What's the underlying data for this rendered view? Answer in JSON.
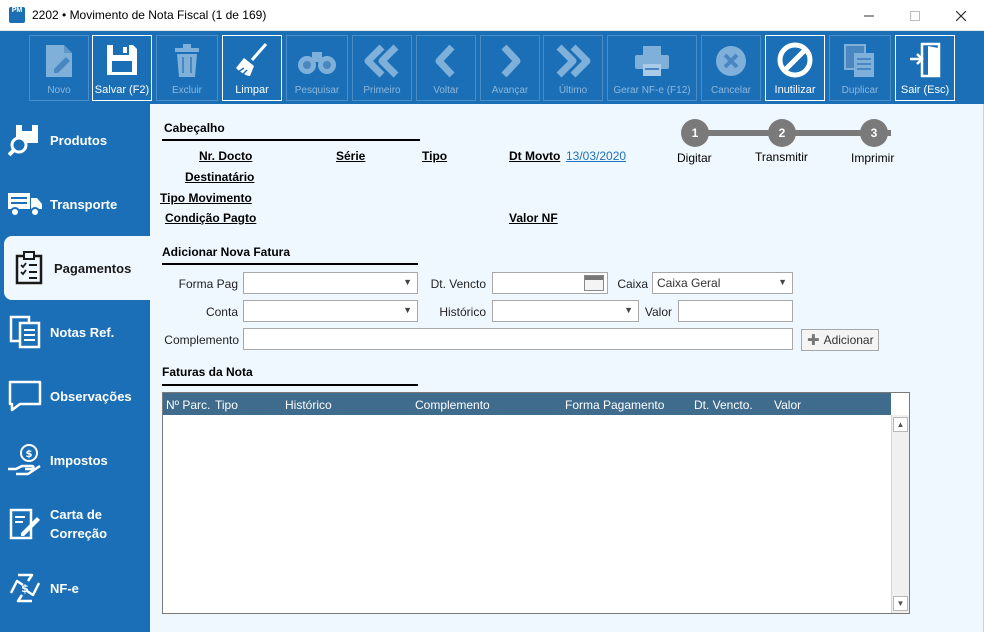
{
  "window": {
    "app_icon_text": "PM",
    "title": "2202 • Movimento de Nota Fiscal (1 de 169)"
  },
  "toolbar": {
    "buttons": [
      {
        "label": "Novo",
        "icon": "new-document-icon",
        "enabled": false
      },
      {
        "label": "Salvar (F2)",
        "icon": "floppy-save-icon",
        "enabled": true
      },
      {
        "label": "Excluir",
        "icon": "trash-icon",
        "enabled": false
      },
      {
        "label": "Limpar",
        "icon": "broom-icon",
        "enabled": true
      },
      {
        "label": "Pesquisar",
        "icon": "binoculars-icon",
        "enabled": false
      },
      {
        "label": "Primeiro",
        "icon": "first-icon",
        "enabled": false
      },
      {
        "label": "Voltar",
        "icon": "previous-icon",
        "enabled": false
      },
      {
        "label": "Avançar",
        "icon": "next-icon",
        "enabled": false
      },
      {
        "label": "Último",
        "icon": "last-icon",
        "enabled": false
      },
      {
        "label": "Gerar NF-e (F12)",
        "icon": "printer-icon",
        "enabled": false
      },
      {
        "label": "Cancelar",
        "icon": "cancel-icon",
        "enabled": false
      },
      {
        "label": "Inutilizar",
        "icon": "prohibited-icon",
        "enabled": true
      },
      {
        "label": "Duplicar",
        "icon": "duplicate-icon",
        "enabled": false
      },
      {
        "label": "Sair (Esc)",
        "icon": "exit-door-icon",
        "enabled": true
      }
    ]
  },
  "sidebar": {
    "items": [
      {
        "label": "Produtos",
        "icon": "product-search-icon",
        "active": false
      },
      {
        "label": "Transporte",
        "icon": "truck-icon",
        "active": false
      },
      {
        "label": "Pagamentos",
        "icon": "clipboard-checklist-icon",
        "active": true
      },
      {
        "label": "Notas Ref.",
        "icon": "documents-icon",
        "active": false
      },
      {
        "label": "Observações",
        "icon": "speech-bubble-icon",
        "active": false
      },
      {
        "label": "Impostos",
        "icon": "money-hand-icon",
        "active": false
      },
      {
        "label": "Carta de",
        "label2": "Correção",
        "icon": "edit-document-icon",
        "active": false
      },
      {
        "label": "NF-e",
        "icon": "nfe-recycle-icon",
        "active": false
      }
    ]
  },
  "header": {
    "title": "Cabeçalho",
    "nr_docto": "Nr. Docto",
    "serie": "Série",
    "tipo": "Tipo",
    "dt_movto": "Dt Movto",
    "dt_movto_value": "13/03/2020",
    "destinatario": "Destinatário",
    "tipo_movimento": "Tipo Movimento",
    "condicao_pagto": "Condição Pagto",
    "valor_nf": "Valor NF"
  },
  "steps": [
    {
      "number": "1",
      "label": "Digitar"
    },
    {
      "number": "2",
      "label": "Transmitir"
    },
    {
      "number": "3",
      "label": "Imprimir"
    }
  ],
  "fatura_form": {
    "title": "Adicionar Nova Fatura",
    "forma_pag_label": "Forma Pag",
    "forma_pag_value": "",
    "dt_vencto_label": "Dt. Vencto",
    "dt_vencto_value": "",
    "caixa_label": "Caixa",
    "caixa_value": "Caixa Geral",
    "conta_label": "Conta",
    "conta_value": "",
    "historico_label": "Histórico",
    "historico_value": "",
    "valor_label": "Valor",
    "valor_value": "",
    "complemento_label": "Complemento",
    "complemento_value": "",
    "add_button": "Adicionar"
  },
  "faturas": {
    "title": "Faturas da Nota",
    "columns": [
      "Nº Parc.",
      "Tipo",
      "Histórico",
      "Complemento",
      "Forma Pagamento",
      "Dt. Vencto.",
      "Valor"
    ],
    "rows": []
  },
  "colors": {
    "brand_blue": "#1b6fb6",
    "panel_bg": "#f0f8ff",
    "grid_header": "#3f6b8c",
    "step_gray": "#7a7a7a"
  }
}
